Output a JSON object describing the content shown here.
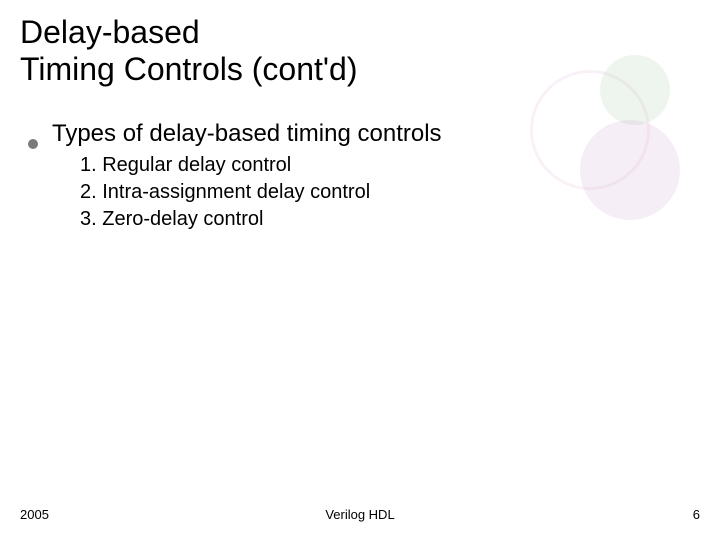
{
  "title_line1": "Delay-based",
  "title_line2": "Timing Controls (cont'd)",
  "bullet": "Types of delay-based timing controls",
  "sublist": {
    "item1": "1. Regular delay control",
    "item2": "2. Intra-assignment delay control",
    "item3": "3. Zero-delay control"
  },
  "footer": {
    "year": "2005",
    "center": "Verilog HDL",
    "page": "6"
  }
}
